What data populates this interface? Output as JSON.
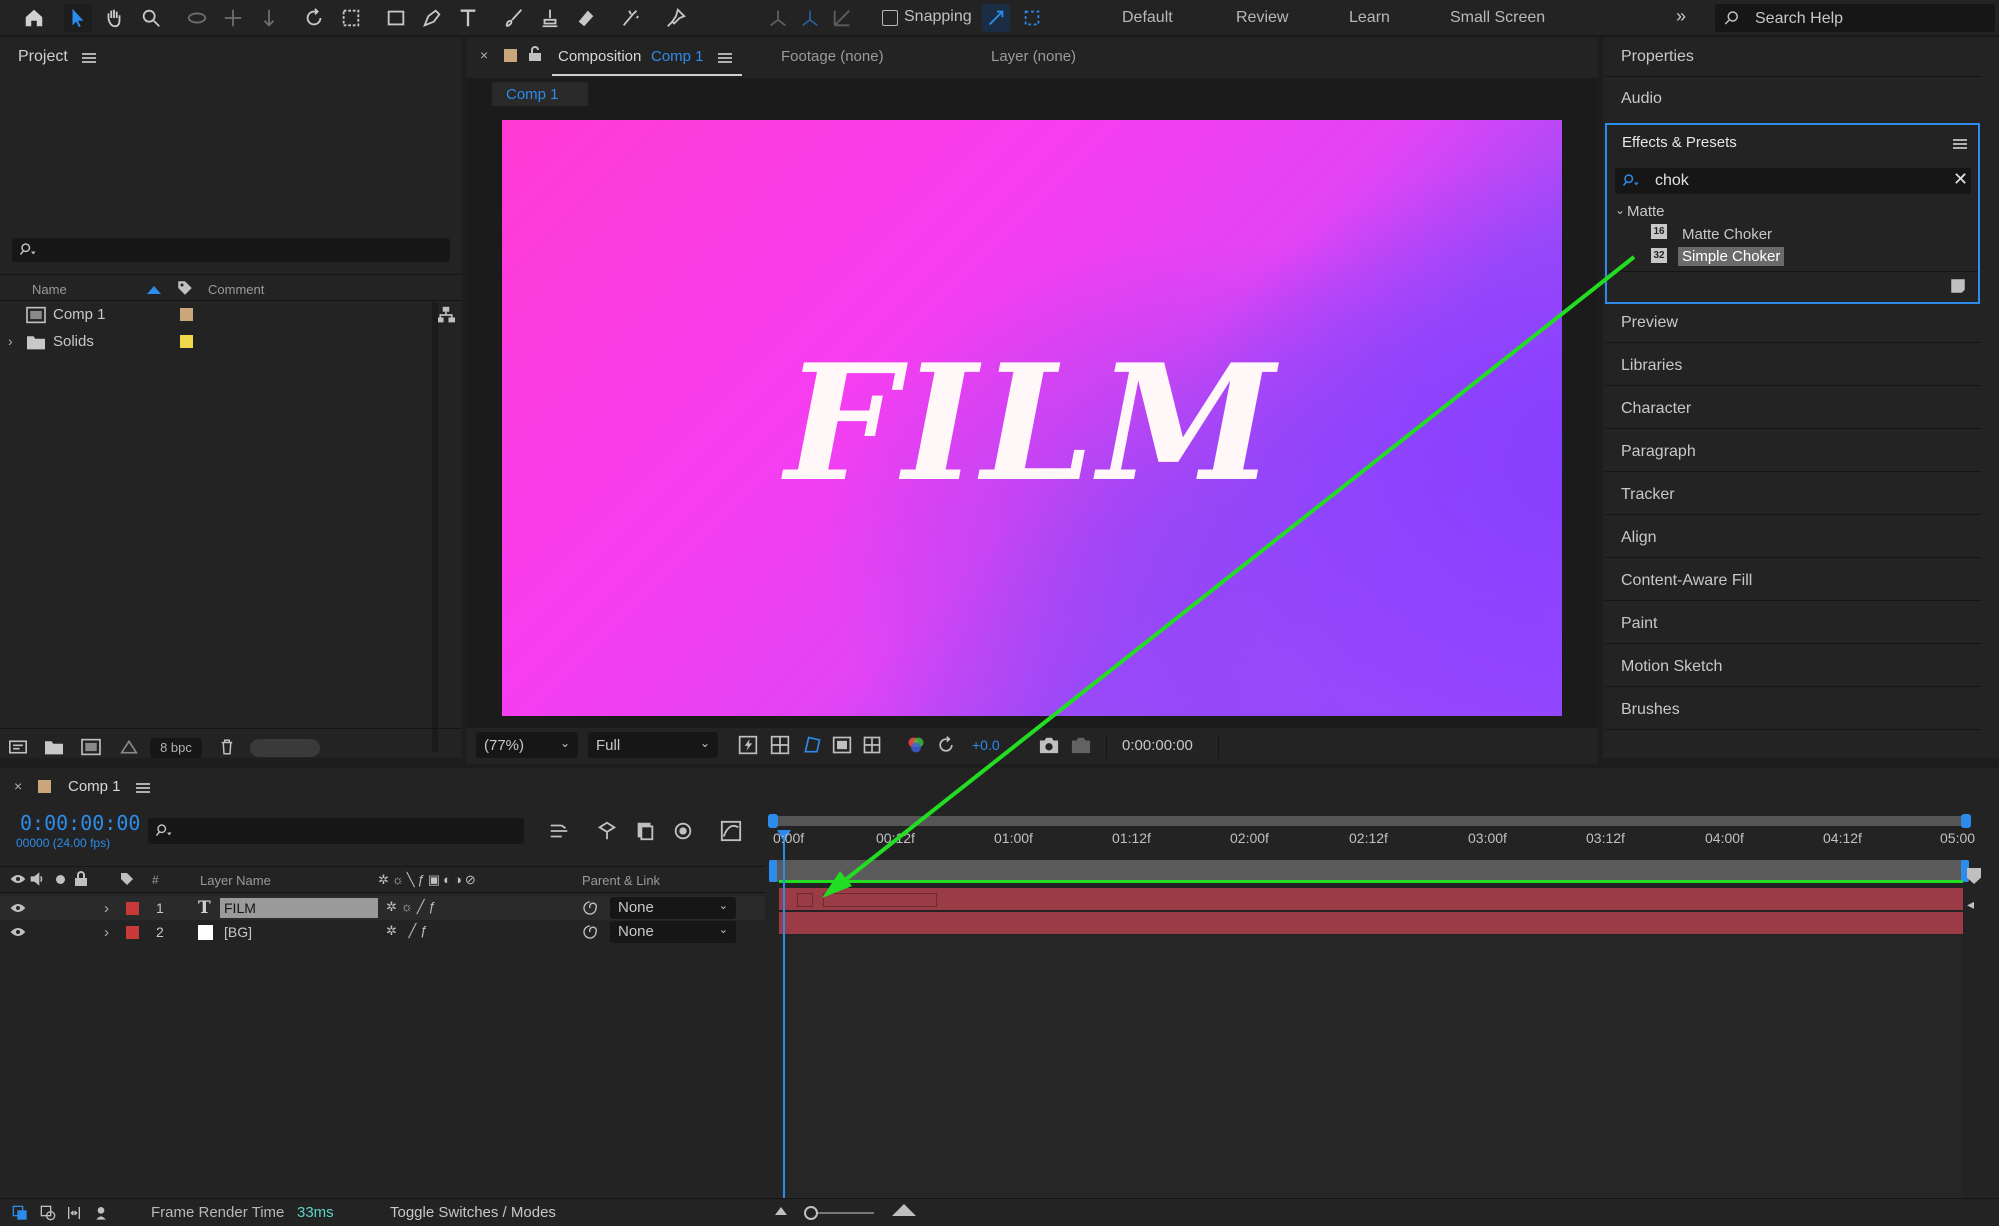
{
  "toolbar": {
    "snapping_label": "Snapping",
    "workspaces": [
      "Default",
      "Review",
      "Learn",
      "Small Screen"
    ],
    "search_placeholder": "Search Help"
  },
  "project": {
    "title": "Project",
    "columns": {
      "name": "Name",
      "comment": "Comment"
    },
    "items": [
      {
        "name": "Comp 1",
        "color": "#c9a77a"
      },
      {
        "name": "Solids",
        "color": "#f0d84a"
      }
    ],
    "bpc": "8 bpc"
  },
  "viewer": {
    "tabs": {
      "composition_prefix": "Composition",
      "composition_name": "Comp 1",
      "footage": "Footage (none)",
      "layer": "Layer (none)"
    },
    "breadcrumb": "Comp 1",
    "canvas_text": "FILM",
    "zoom": "(77%)",
    "resolution": "Full",
    "exposure": "+0.0",
    "timecode": "0:00:00:00"
  },
  "right_panels": {
    "properties": "Properties",
    "audio": "Audio",
    "effects": {
      "title": "Effects & Presets",
      "search_value": "chok",
      "category": "Matte",
      "items": [
        {
          "label": "Matte Choker",
          "badge": "16",
          "selected": false
        },
        {
          "label": "Simple Choker",
          "badge": "32",
          "selected": true
        }
      ]
    },
    "others": [
      "Preview",
      "Libraries",
      "Character",
      "Paragraph",
      "Tracker",
      "Align",
      "Content-Aware Fill",
      "Paint",
      "Motion Sketch",
      "Brushes"
    ]
  },
  "timeline": {
    "comp_tab": "Comp 1",
    "current_time": "0:00:00:00",
    "frame_info": "00000 (24.00 fps)",
    "columns": {
      "num": "#",
      "layer_name": "Layer Name",
      "parent": "Parent & Link"
    },
    "layers": [
      {
        "num": "1",
        "type": "T",
        "name": "FILM",
        "color": "#c83a3a",
        "parent": "None"
      },
      {
        "num": "2",
        "type": "",
        "name": "[BG]",
        "color": "#c83a3a",
        "parent": "None"
      }
    ],
    "ruler": [
      "0:00f",
      "00:12f",
      "01:00f",
      "01:12f",
      "02:00f",
      "02:12f",
      "03:00f",
      "03:12f",
      "04:00f",
      "04:12f",
      "05:00"
    ]
  },
  "status": {
    "render_label": "Frame Render Time",
    "render_value": "33ms",
    "toggle_label": "Toggle Switches / Modes"
  },
  "colors": {
    "accent": "#2d8ceb",
    "annotation_arrow": "#22dd22",
    "layer_bar": "#9a3b45"
  }
}
